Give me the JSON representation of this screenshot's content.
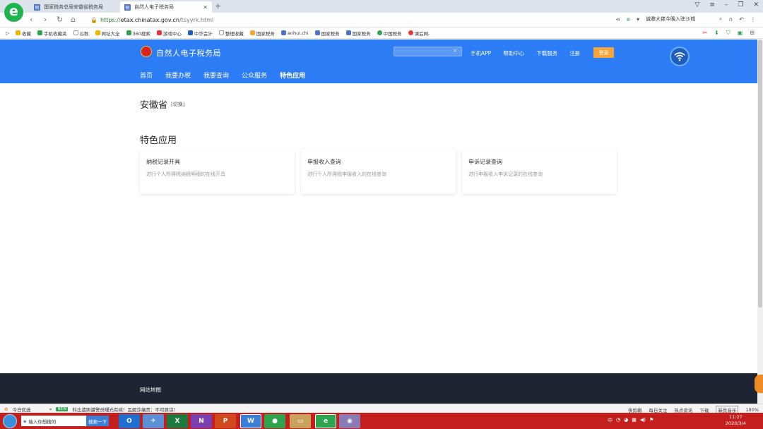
{
  "browser": {
    "logo_glyph": "e",
    "tabs": [
      {
        "label": "国家税务总局安徽省税务局",
        "active": false
      },
      {
        "label": "自然人电子税务局",
        "active": true
      }
    ],
    "new_tab": "+",
    "url_scheme": "https://",
    "url_host": "etax.chinatax.gov.cn",
    "url_path": "/tsyyrk.html",
    "search_text": "诚邀大佬今晚入驻沙城",
    "bookmarks": [
      {
        "label": "收藏",
        "color": "#f5b400"
      },
      {
        "label": "手机收藏夹",
        "color": "#2ea44f"
      },
      {
        "label": "谷歌",
        "color": "#ffffff"
      },
      {
        "label": "网址大全",
        "color": "#f5b400"
      },
      {
        "label": "360搜索",
        "color": "#2ea44f"
      },
      {
        "label": "游戏中心",
        "color": "#e53935"
      },
      {
        "label": "中华会计",
        "color": "#1e5fbe"
      },
      {
        "label": "整理收藏",
        "color": "#ffffff"
      },
      {
        "label": "国家税务",
        "color": "#f5a63a"
      },
      {
        "label": "anhui.chi",
        "color": "#4d73c8"
      },
      {
        "label": "国家税务",
        "color": "#4d73c8"
      },
      {
        "label": "国家税务",
        "color": "#4d73c8"
      },
      {
        "label": "中国税务",
        "color": "#2ea44f"
      },
      {
        "label": "课后网-",
        "color": "#e53935"
      }
    ]
  },
  "site": {
    "title": "自然人电子税务局",
    "header_links": [
      "手机APP",
      "帮助中心",
      "下载服务",
      "注册"
    ],
    "login": "登录",
    "nav": [
      {
        "label": "首页",
        "active": false
      },
      {
        "label": "我要办税",
        "active": false
      },
      {
        "label": "我要查询",
        "active": false
      },
      {
        "label": "公众服务",
        "active": false
      },
      {
        "label": "特色应用",
        "active": true
      }
    ]
  },
  "content": {
    "province": "安徽省",
    "switch": "[切换]",
    "section_title": "特色应用",
    "cards": [
      {
        "title": "纳税记录开具",
        "desc": "进行个人所得税纳税明细的在线开具"
      },
      {
        "title": "申报收入查询",
        "desc": "进行个人所得税申报收入的在线查询"
      },
      {
        "title": "申诉记录查询",
        "desc": "进行申报收入申诉记录的在线查询"
      }
    ]
  },
  "footer": {
    "link": "网站地图"
  },
  "statusbar": {
    "left_item": "今日优选",
    "news_badge": "NEW",
    "news_text": "科比遗照遭警员曝光有续！瓦妮莎痛责：不可原谅！",
    "right_items": [
      "快剪辑",
      "每日关注",
      "热点资讯",
      "下载"
    ],
    "tag": "新民音乐",
    "zoom": "100%"
  },
  "taskbar": {
    "search_placeholder": "输入你想搜的",
    "search_button": "搜索一下",
    "apps": [
      {
        "label": "O",
        "color": "#1e6fd0"
      },
      {
        "label": "✈",
        "color": "#5b8fd8"
      },
      {
        "label": "X",
        "color": "#1f7a3f"
      },
      {
        "label": "N",
        "color": "#7b3fb0"
      },
      {
        "label": "P",
        "color": "#d04a1e"
      },
      {
        "label": "W",
        "color": "#3c7fd8"
      },
      {
        "label": "●",
        "color": "#2ea44f"
      },
      {
        "label": "▭",
        "color": "#c9a35b"
      },
      {
        "label": "e",
        "color": "#2ea44f"
      },
      {
        "label": "◉",
        "color": "#8a7bb5"
      }
    ],
    "time": "11:27",
    "date": "2020/3/4"
  }
}
